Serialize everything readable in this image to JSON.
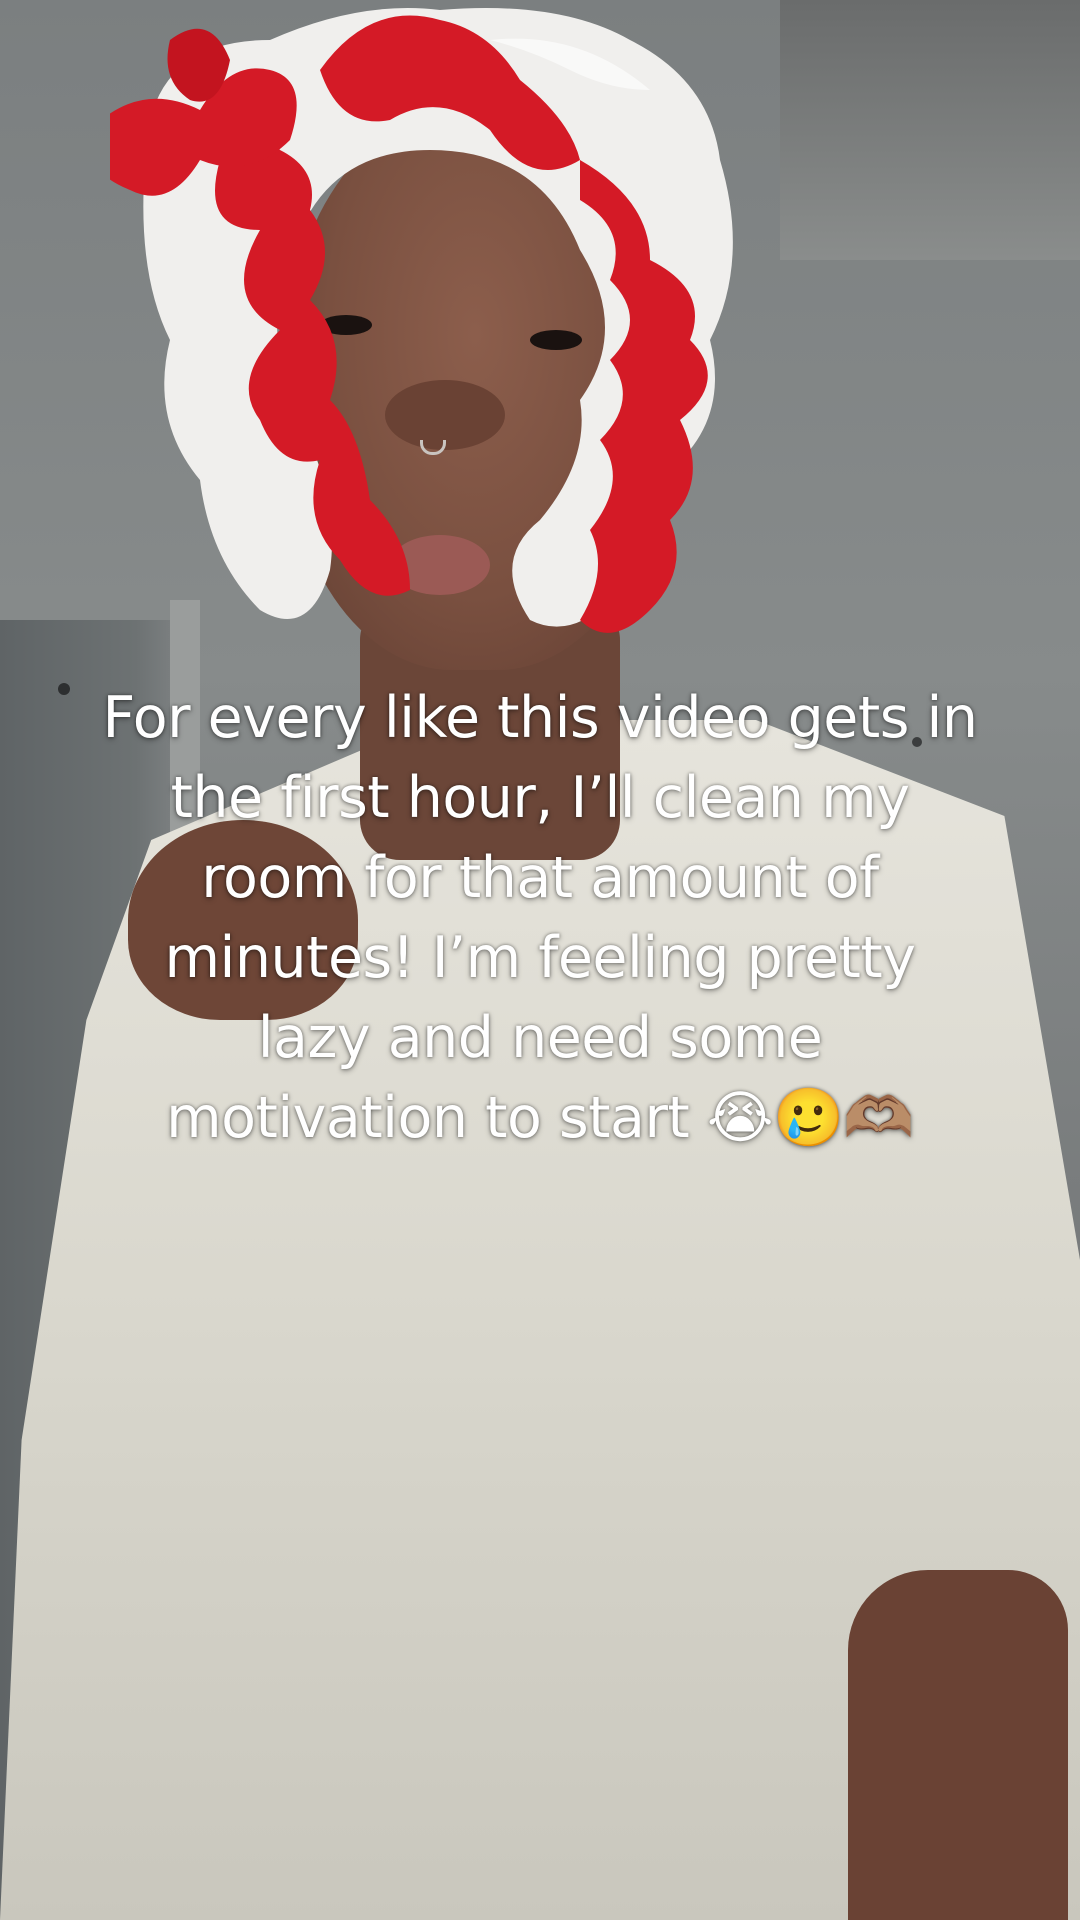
{
  "caption": {
    "text": "For every like this video gets in the first hour, I’ll clean my room for that amount of minutes! I’m feeling pretty lazy and need some motivation to start 😭🥲🫶🏽"
  },
  "colors": {
    "caption_text": "#ffffff",
    "bonnet_red": "#d81824",
    "bonnet_white": "#f2f2f0",
    "shirt": "#e2e0d7",
    "wall": "#828685"
  }
}
